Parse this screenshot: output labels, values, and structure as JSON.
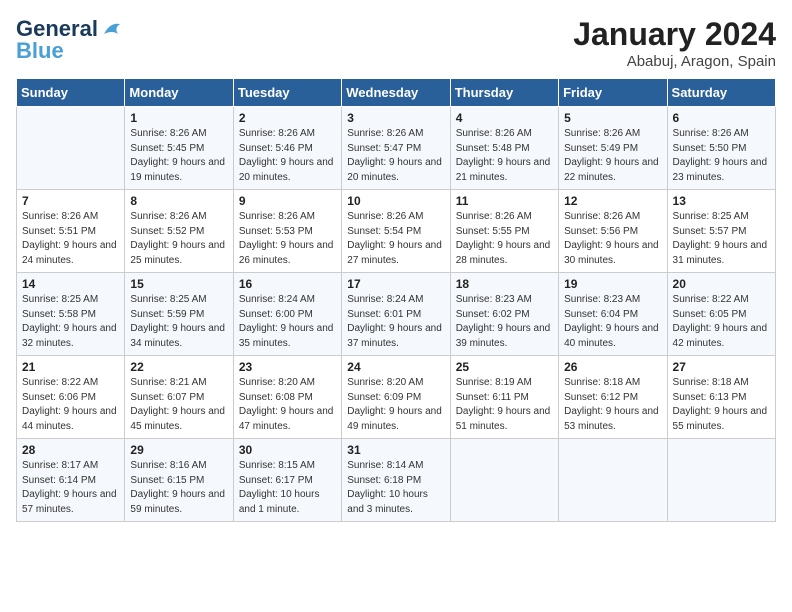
{
  "header": {
    "logo_general": "General",
    "logo_blue": "Blue",
    "month_title": "January 2024",
    "location": "Ababuj, Aragon, Spain"
  },
  "weekdays": [
    "Sunday",
    "Monday",
    "Tuesday",
    "Wednesday",
    "Thursday",
    "Friday",
    "Saturday"
  ],
  "weeks": [
    [
      {
        "day": "",
        "sunrise": "",
        "sunset": "",
        "daylight": ""
      },
      {
        "day": "1",
        "sunrise": "Sunrise: 8:26 AM",
        "sunset": "Sunset: 5:45 PM",
        "daylight": "Daylight: 9 hours and 19 minutes."
      },
      {
        "day": "2",
        "sunrise": "Sunrise: 8:26 AM",
        "sunset": "Sunset: 5:46 PM",
        "daylight": "Daylight: 9 hours and 20 minutes."
      },
      {
        "day": "3",
        "sunrise": "Sunrise: 8:26 AM",
        "sunset": "Sunset: 5:47 PM",
        "daylight": "Daylight: 9 hours and 20 minutes."
      },
      {
        "day": "4",
        "sunrise": "Sunrise: 8:26 AM",
        "sunset": "Sunset: 5:48 PM",
        "daylight": "Daylight: 9 hours and 21 minutes."
      },
      {
        "day": "5",
        "sunrise": "Sunrise: 8:26 AM",
        "sunset": "Sunset: 5:49 PM",
        "daylight": "Daylight: 9 hours and 22 minutes."
      },
      {
        "day": "6",
        "sunrise": "Sunrise: 8:26 AM",
        "sunset": "Sunset: 5:50 PM",
        "daylight": "Daylight: 9 hours and 23 minutes."
      }
    ],
    [
      {
        "day": "7",
        "sunrise": "Sunrise: 8:26 AM",
        "sunset": "Sunset: 5:51 PM",
        "daylight": "Daylight: 9 hours and 24 minutes."
      },
      {
        "day": "8",
        "sunrise": "Sunrise: 8:26 AM",
        "sunset": "Sunset: 5:52 PM",
        "daylight": "Daylight: 9 hours and 25 minutes."
      },
      {
        "day": "9",
        "sunrise": "Sunrise: 8:26 AM",
        "sunset": "Sunset: 5:53 PM",
        "daylight": "Daylight: 9 hours and 26 minutes."
      },
      {
        "day": "10",
        "sunrise": "Sunrise: 8:26 AM",
        "sunset": "Sunset: 5:54 PM",
        "daylight": "Daylight: 9 hours and 27 minutes."
      },
      {
        "day": "11",
        "sunrise": "Sunrise: 8:26 AM",
        "sunset": "Sunset: 5:55 PM",
        "daylight": "Daylight: 9 hours and 28 minutes."
      },
      {
        "day": "12",
        "sunrise": "Sunrise: 8:26 AM",
        "sunset": "Sunset: 5:56 PM",
        "daylight": "Daylight: 9 hours and 30 minutes."
      },
      {
        "day": "13",
        "sunrise": "Sunrise: 8:25 AM",
        "sunset": "Sunset: 5:57 PM",
        "daylight": "Daylight: 9 hours and 31 minutes."
      }
    ],
    [
      {
        "day": "14",
        "sunrise": "Sunrise: 8:25 AM",
        "sunset": "Sunset: 5:58 PM",
        "daylight": "Daylight: 9 hours and 32 minutes."
      },
      {
        "day": "15",
        "sunrise": "Sunrise: 8:25 AM",
        "sunset": "Sunset: 5:59 PM",
        "daylight": "Daylight: 9 hours and 34 minutes."
      },
      {
        "day": "16",
        "sunrise": "Sunrise: 8:24 AM",
        "sunset": "Sunset: 6:00 PM",
        "daylight": "Daylight: 9 hours and 35 minutes."
      },
      {
        "day": "17",
        "sunrise": "Sunrise: 8:24 AM",
        "sunset": "Sunset: 6:01 PM",
        "daylight": "Daylight: 9 hours and 37 minutes."
      },
      {
        "day": "18",
        "sunrise": "Sunrise: 8:23 AM",
        "sunset": "Sunset: 6:02 PM",
        "daylight": "Daylight: 9 hours and 39 minutes."
      },
      {
        "day": "19",
        "sunrise": "Sunrise: 8:23 AM",
        "sunset": "Sunset: 6:04 PM",
        "daylight": "Daylight: 9 hours and 40 minutes."
      },
      {
        "day": "20",
        "sunrise": "Sunrise: 8:22 AM",
        "sunset": "Sunset: 6:05 PM",
        "daylight": "Daylight: 9 hours and 42 minutes."
      }
    ],
    [
      {
        "day": "21",
        "sunrise": "Sunrise: 8:22 AM",
        "sunset": "Sunset: 6:06 PM",
        "daylight": "Daylight: 9 hours and 44 minutes."
      },
      {
        "day": "22",
        "sunrise": "Sunrise: 8:21 AM",
        "sunset": "Sunset: 6:07 PM",
        "daylight": "Daylight: 9 hours and 45 minutes."
      },
      {
        "day": "23",
        "sunrise": "Sunrise: 8:20 AM",
        "sunset": "Sunset: 6:08 PM",
        "daylight": "Daylight: 9 hours and 47 minutes."
      },
      {
        "day": "24",
        "sunrise": "Sunrise: 8:20 AM",
        "sunset": "Sunset: 6:09 PM",
        "daylight": "Daylight: 9 hours and 49 minutes."
      },
      {
        "day": "25",
        "sunrise": "Sunrise: 8:19 AM",
        "sunset": "Sunset: 6:11 PM",
        "daylight": "Daylight: 9 hours and 51 minutes."
      },
      {
        "day": "26",
        "sunrise": "Sunrise: 8:18 AM",
        "sunset": "Sunset: 6:12 PM",
        "daylight": "Daylight: 9 hours and 53 minutes."
      },
      {
        "day": "27",
        "sunrise": "Sunrise: 8:18 AM",
        "sunset": "Sunset: 6:13 PM",
        "daylight": "Daylight: 9 hours and 55 minutes."
      }
    ],
    [
      {
        "day": "28",
        "sunrise": "Sunrise: 8:17 AM",
        "sunset": "Sunset: 6:14 PM",
        "daylight": "Daylight: 9 hours and 57 minutes."
      },
      {
        "day": "29",
        "sunrise": "Sunrise: 8:16 AM",
        "sunset": "Sunset: 6:15 PM",
        "daylight": "Daylight: 9 hours and 59 minutes."
      },
      {
        "day": "30",
        "sunrise": "Sunrise: 8:15 AM",
        "sunset": "Sunset: 6:17 PM",
        "daylight": "Daylight: 10 hours and 1 minute."
      },
      {
        "day": "31",
        "sunrise": "Sunrise: 8:14 AM",
        "sunset": "Sunset: 6:18 PM",
        "daylight": "Daylight: 10 hours and 3 minutes."
      },
      {
        "day": "",
        "sunrise": "",
        "sunset": "",
        "daylight": ""
      },
      {
        "day": "",
        "sunrise": "",
        "sunset": "",
        "daylight": ""
      },
      {
        "day": "",
        "sunrise": "",
        "sunset": "",
        "daylight": ""
      }
    ]
  ]
}
